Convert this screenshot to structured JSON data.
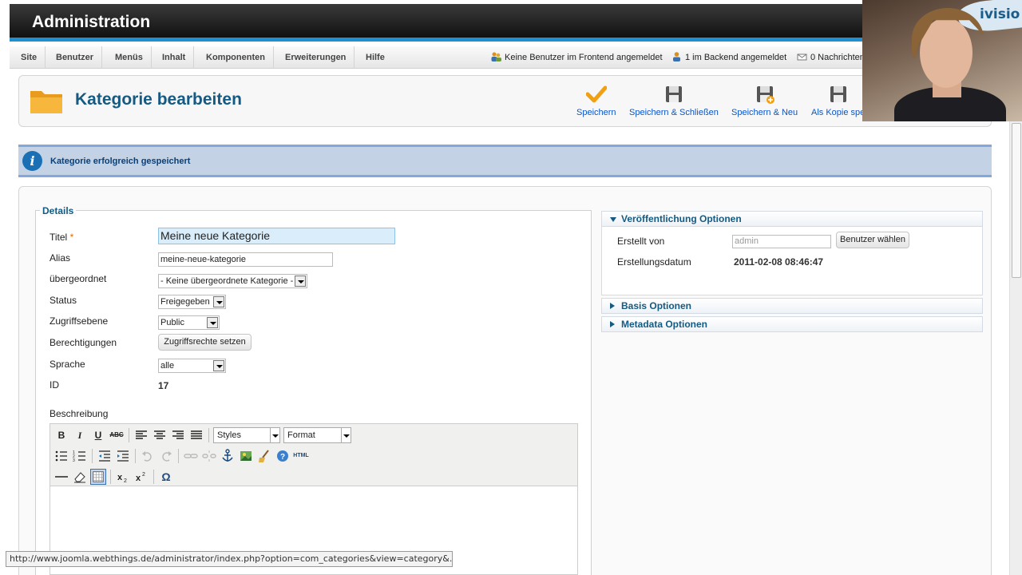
{
  "header": {
    "title": "Administration"
  },
  "menu": {
    "items": [
      {
        "label": "Site"
      },
      {
        "label": "Benutzer"
      },
      {
        "label": "Menüs"
      },
      {
        "label": "Inhalt"
      },
      {
        "label": "Komponenten"
      },
      {
        "label": "Erweiterungen"
      },
      {
        "label": "Hilfe"
      }
    ],
    "status": {
      "frontend": "Keine Benutzer im Frontend angemeldet",
      "backend": "1 im Backend angemeldet",
      "messages": "0 Nachrichten"
    }
  },
  "toolbar": {
    "page_title": "Kategorie bearbeiten",
    "buttons": [
      {
        "label": "Speichern",
        "icon": "checkmark-icon"
      },
      {
        "label": "Speichern & Schließen",
        "icon": "floppy-icon"
      },
      {
        "label": "Speichern & Neu",
        "icon": "floppy-plus-icon"
      },
      {
        "label": "Als Kopie spe",
        "icon": "floppy-copy-icon"
      }
    ]
  },
  "message": {
    "text": "Kategorie erfolgreich gespeichert"
  },
  "details": {
    "legend": "Details",
    "title_label": "Titel",
    "required_mark": "*",
    "title_value": "Meine neue Kategorie",
    "alias_label": "Alias",
    "alias_value": "meine-neue-kategorie",
    "parent_label": "übergeordnet",
    "parent_value": "- Keine übergeordnete Kategorie -",
    "status_label": "Status",
    "status_value": "Freigegeben",
    "access_label": "Zugriffsebene",
    "access_value": "Public",
    "permissions_label": "Berechtigungen",
    "permissions_button": "Zugriffsrechte setzen",
    "language_label": "Sprache",
    "language_value": "alle",
    "id_label": "ID",
    "id_value": "17",
    "description_label": "Beschreibung"
  },
  "editor": {
    "styles_select": "Styles",
    "format_select": "Format",
    "bold": "B",
    "italic": "I",
    "underline": "U",
    "strikethrough": "ABC",
    "html": "HTML",
    "omega": "Ω"
  },
  "panels": {
    "publishing": {
      "title": "Veröffentlichung Optionen",
      "created_by_label": "Erstellt von",
      "created_by_value": "admin",
      "select_user_button": "Benutzer wählen",
      "created_date_label": "Erstellungsdatum",
      "created_date_value": "2011-02-08 08:46:47"
    },
    "basic": {
      "title": "Basis Optionen"
    },
    "metadata": {
      "title": "Metadata Optionen"
    }
  },
  "webcam": {
    "banner_text": "ivisio"
  },
  "statusbar": {
    "url": "http://www.joomla.webthings.de/administrator/index.php?option=com_categories&view=category&..."
  },
  "colors": {
    "accent": "#1f8fcf",
    "title": "#145a82",
    "link": "#0b55c4",
    "message_bg": "#c3d2e5"
  }
}
